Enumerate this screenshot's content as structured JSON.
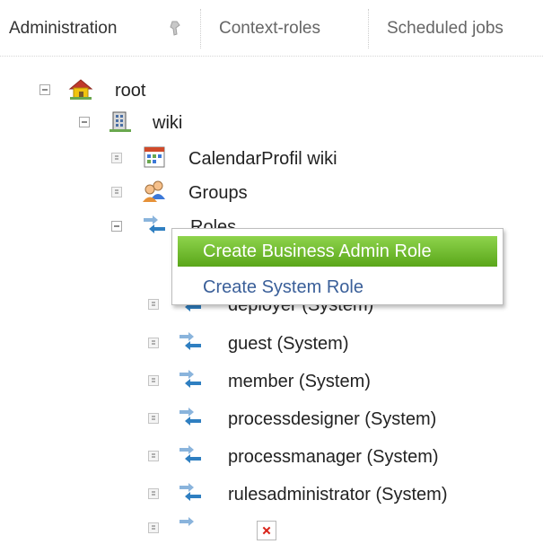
{
  "tabs": [
    {
      "label": "Administration",
      "active": true
    },
    {
      "label": "Context-roles",
      "active": false
    },
    {
      "label": "Scheduled jobs",
      "active": false
    }
  ],
  "tree": {
    "root": {
      "label": "root",
      "icon": "house-icon"
    },
    "wiki": {
      "label": "wiki",
      "icon": "building-icon"
    },
    "calendar": {
      "label": "CalendarProfil wiki",
      "icon": "calendar-icon"
    },
    "groups": {
      "label": "Groups",
      "icon": "users-icon"
    },
    "roles": {
      "label": "Roles",
      "icon": "role-arrows-icon"
    },
    "role_items": [
      {
        "label": "deployer (System)"
      },
      {
        "label": "guest (System)"
      },
      {
        "label": "member (System)"
      },
      {
        "label": "processdesigner (System)"
      },
      {
        "label": "processmanager (System)"
      },
      {
        "label": "rulesadministrator (System)"
      }
    ]
  },
  "context_menu": {
    "items": [
      {
        "label": "Create Business Admin Role",
        "highlighted": true
      },
      {
        "label": "Create System Role",
        "highlighted": false
      }
    ]
  },
  "colors": {
    "menu_highlight": "#6cbf2a",
    "link_blue": "#3a5f99",
    "arrow_blue": "#2f7fc1"
  }
}
